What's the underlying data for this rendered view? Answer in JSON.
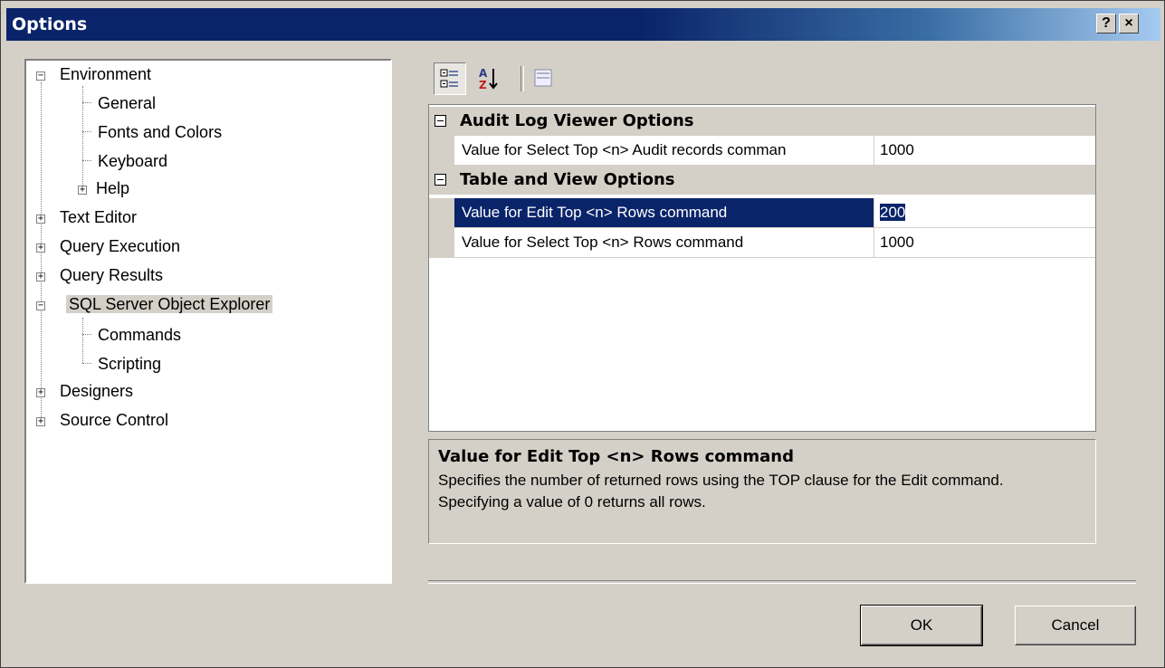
{
  "window": {
    "title": "Options",
    "help_label": "?",
    "close_label": "×"
  },
  "tree": [
    {
      "label": "Environment",
      "expander": "minus"
    },
    {
      "label": "General"
    },
    {
      "label": "Fonts and Colors"
    },
    {
      "label": "Keyboard"
    },
    {
      "label": "Help",
      "expander": "plus"
    },
    {
      "label": "Text Editor",
      "expander": "plus"
    },
    {
      "label": "Query Execution",
      "expander": "plus"
    },
    {
      "label": "Query Results",
      "expander": "plus"
    },
    {
      "label": "SQL Server Object Explorer",
      "expander": "minus",
      "selected": true
    },
    {
      "label": "Commands"
    },
    {
      "label": "Scripting"
    },
    {
      "label": "Designers",
      "expander": "plus"
    },
    {
      "label": "Source Control",
      "expander": "plus"
    }
  ],
  "toolbar": {
    "categorized_icon": "categorized-icon",
    "alphabetical_icon": "sort-az-icon",
    "property_pages_icon": "property-pages-icon"
  },
  "grid": {
    "categories": [
      {
        "label": "Audit Log Viewer Options",
        "properties": [
          {
            "name": "Value for Select Top <n> Audit records comman",
            "value": "1000"
          }
        ]
      },
      {
        "label": "Table and View Options",
        "properties": [
          {
            "name": "Value for Edit Top <n> Rows command",
            "value": "200",
            "selected": true
          },
          {
            "name": "Value for Select Top <n> Rows command",
            "value": "1000"
          }
        ]
      }
    ]
  },
  "description": {
    "title": "Value for Edit Top <n> Rows command",
    "text": "Specifies the number of returned rows using the TOP clause for the Edit command. Specifying a value of 0 returns all rows."
  },
  "buttons": {
    "ok": "OK",
    "cancel": "Cancel"
  }
}
